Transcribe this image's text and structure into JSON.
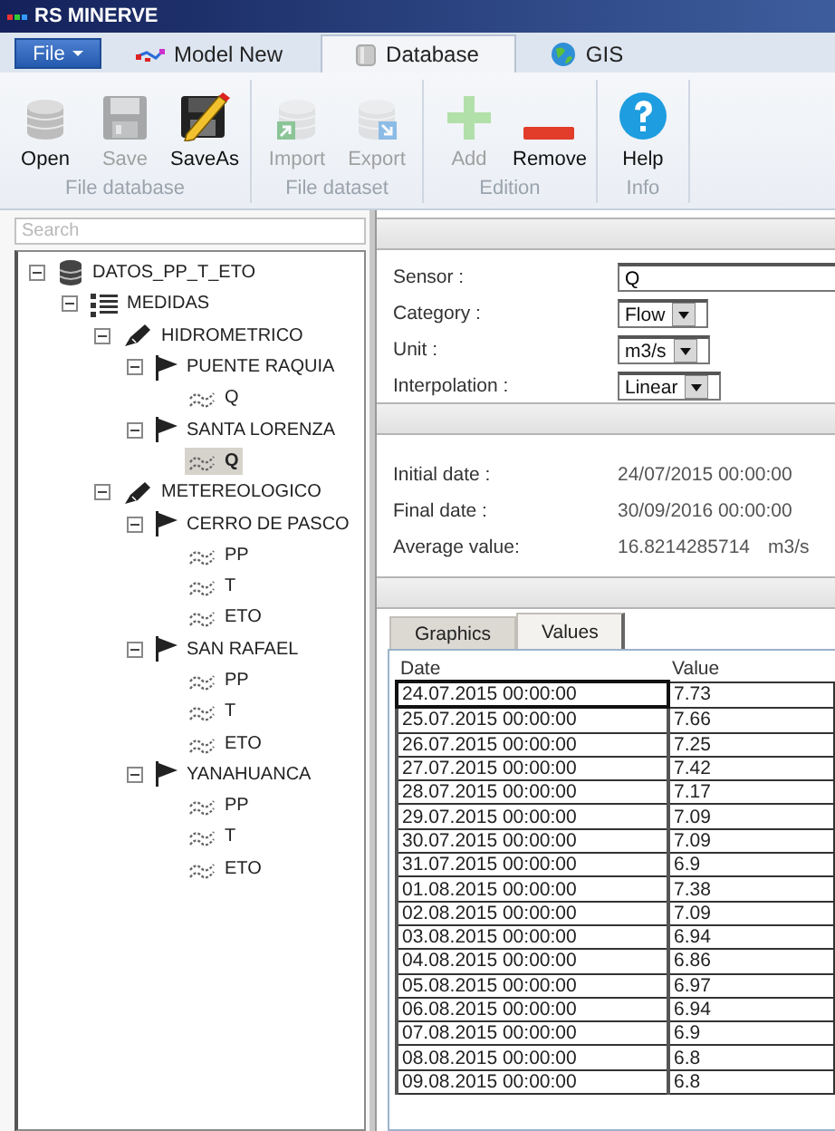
{
  "window": {
    "title": "RS MINERVE"
  },
  "menu_tabs": [
    {
      "label": "File",
      "kind": "file"
    },
    {
      "label": "Model New",
      "kind": "tab",
      "selected": false
    },
    {
      "label": "Database",
      "kind": "tab",
      "selected": true
    },
    {
      "label": "GIS",
      "kind": "tab",
      "selected": false
    }
  ],
  "ribbon": [
    {
      "label": "File database",
      "buttons": [
        {
          "label": "Open",
          "disabled": false
        },
        {
          "label": "Save",
          "disabled": true
        },
        {
          "label": "SaveAs",
          "disabled": false
        }
      ]
    },
    {
      "label": "File dataset",
      "buttons": [
        {
          "label": "Import",
          "disabled": true
        },
        {
          "label": "Export",
          "disabled": true
        }
      ]
    },
    {
      "label": "Edition",
      "buttons": [
        {
          "label": "Add",
          "disabled": true
        },
        {
          "label": "Remove",
          "disabled": false
        }
      ]
    },
    {
      "label": "Info",
      "buttons": [
        {
          "label": "Help",
          "disabled": false
        }
      ]
    }
  ],
  "search": {
    "placeholder": "Search"
  },
  "tree": [
    {
      "label": "DATOS_PP_T_ETO",
      "kind": "database",
      "expanded": true,
      "selected": false,
      "children": [
        {
          "label": "MEDIDAS",
          "kind": "group",
          "expanded": true,
          "selected": false,
          "children": [
            {
              "label": "HIDROMETRICO",
              "kind": "category",
              "expanded": true,
              "selected": false,
              "children": [
                {
                  "label": "PUENTE RAQUIA",
                  "kind": "station",
                  "expanded": true,
                  "selected": false,
                  "children": [
                    {
                      "label": "Q",
                      "kind": "series",
                      "selected": false
                    }
                  ]
                },
                {
                  "label": "SANTA LORENZA",
                  "kind": "station",
                  "expanded": true,
                  "selected": false,
                  "children": [
                    {
                      "label": "Q",
                      "kind": "series",
                      "selected": true
                    }
                  ]
                }
              ]
            },
            {
              "label": "METEREOLOGICO",
              "kind": "category",
              "expanded": true,
              "selected": false,
              "children": [
                {
                  "label": "CERRO DE PASCO",
                  "kind": "station",
                  "expanded": true,
                  "selected": false,
                  "children": [
                    {
                      "label": "PP",
                      "kind": "series",
                      "selected": false
                    },
                    {
                      "label": "T",
                      "kind": "series",
                      "selected": false
                    },
                    {
                      "label": "ETO",
                      "kind": "series",
                      "selected": false
                    }
                  ]
                },
                {
                  "label": "SAN RAFAEL",
                  "kind": "station",
                  "expanded": true,
                  "selected": false,
                  "children": [
                    {
                      "label": "PP",
                      "kind": "series",
                      "selected": false
                    },
                    {
                      "label": "T",
                      "kind": "series",
                      "selected": false
                    },
                    {
                      "label": "ETO",
                      "kind": "series",
                      "selected": false
                    }
                  ]
                },
                {
                  "label": "YANAHUANCA",
                  "kind": "station",
                  "expanded": true,
                  "selected": false,
                  "children": [
                    {
                      "label": "PP",
                      "kind": "series",
                      "selected": false
                    },
                    {
                      "label": "T",
                      "kind": "series",
                      "selected": false
                    },
                    {
                      "label": "ETO",
                      "kind": "series",
                      "selected": false
                    }
                  ]
                }
              ]
            }
          ]
        }
      ]
    }
  ],
  "sensor_form": [
    {
      "label": "Sensor :",
      "kind": "text",
      "value": "Q"
    },
    {
      "label": "Category :",
      "kind": "select",
      "value": "Flow"
    },
    {
      "label": "Unit :",
      "kind": "select",
      "value": "m3/s"
    },
    {
      "label": "Interpolation :",
      "kind": "select",
      "value": "Linear"
    }
  ],
  "summary": [
    {
      "label": "Initial date :",
      "value": "24/07/2015 00:00:00"
    },
    {
      "label": "Final date :",
      "value": "30/09/2016 00:00:00"
    },
    {
      "label": "Average value:",
      "value": "16.8214285714",
      "unit": "m3/s"
    }
  ],
  "view_tabs": [
    {
      "label": "Graphics",
      "selected": false
    },
    {
      "label": "Values",
      "selected": true
    }
  ],
  "table": {
    "columns": [
      "Date",
      "Value"
    ],
    "rows": [
      {
        "date": "24.07.2015 00:00:00",
        "value": "7.73",
        "selected": true
      },
      {
        "date": "25.07.2015 00:00:00",
        "value": "7.66",
        "selected": false
      },
      {
        "date": "26.07.2015 00:00:00",
        "value": "7.25",
        "selected": false
      },
      {
        "date": "27.07.2015 00:00:00",
        "value": "7.42",
        "selected": false
      },
      {
        "date": "28.07.2015 00:00:00",
        "value": "7.17",
        "selected": false
      },
      {
        "date": "29.07.2015 00:00:00",
        "value": "7.09",
        "selected": false
      },
      {
        "date": "30.07.2015 00:00:00",
        "value": "7.09",
        "selected": false
      },
      {
        "date": "31.07.2015 00:00:00",
        "value": "6.9",
        "selected": false
      },
      {
        "date": "01.08.2015 00:00:00",
        "value": "7.38",
        "selected": false
      },
      {
        "date": "02.08.2015 00:00:00",
        "value": "7.09",
        "selected": false
      },
      {
        "date": "03.08.2015 00:00:00",
        "value": "6.94",
        "selected": false
      },
      {
        "date": "04.08.2015 00:00:00",
        "value": "6.86",
        "selected": false
      },
      {
        "date": "05.08.2015 00:00:00",
        "value": "6.97",
        "selected": false
      },
      {
        "date": "06.08.2015 00:00:00",
        "value": "6.94",
        "selected": false
      },
      {
        "date": "07.08.2015 00:00:00",
        "value": "6.9",
        "selected": false
      },
      {
        "date": "08.08.2015 00:00:00",
        "value": "6.8",
        "selected": false
      },
      {
        "date": "09.08.2015 00:00:00",
        "value": "6.8",
        "selected": false
      }
    ]
  }
}
